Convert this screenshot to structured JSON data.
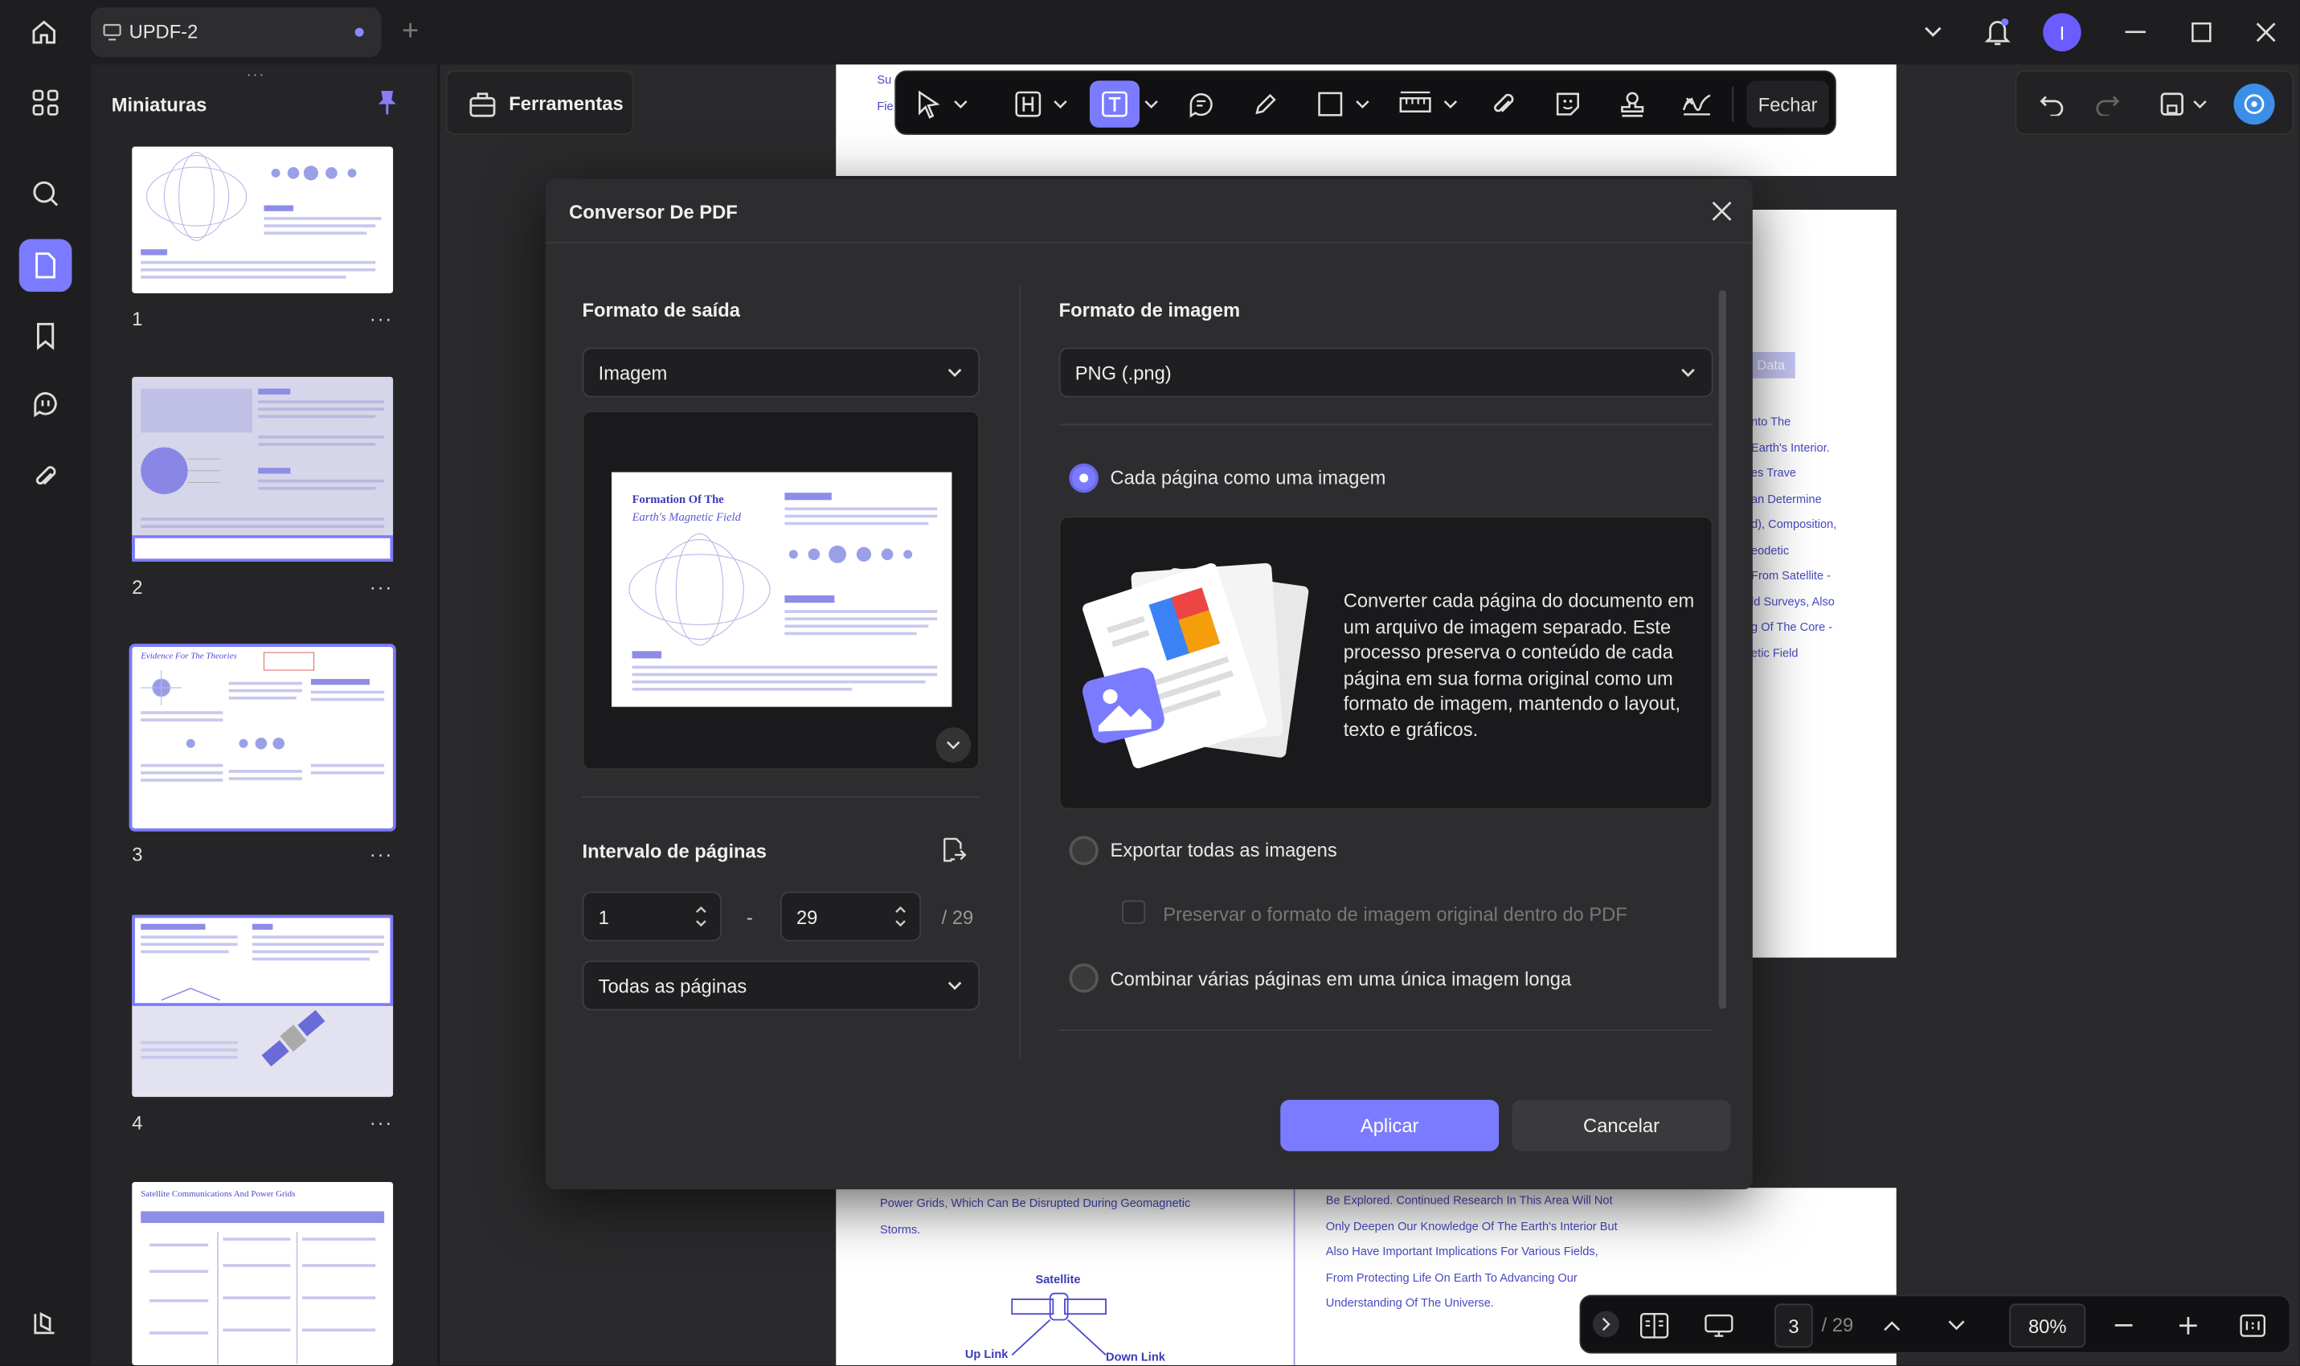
{
  "app": {
    "tab_title": "UPDF-2",
    "user_initial": "I"
  },
  "sidebar": {
    "panel_title": "Miniaturas",
    "pages": [
      {
        "num": "1"
      },
      {
        "num": "2"
      },
      {
        "num": "3"
      },
      {
        "num": "4"
      }
    ],
    "more": "···"
  },
  "toolbar": {
    "tools_label": "Ferramentas",
    "close_label": "Fechar"
  },
  "doc": {
    "top_text_1": "Su",
    "top_text_2": "Fie",
    "right_lines": [
      "Data",
      "nto The",
      "Earth's Interior.",
      "es Trave",
      "an Determine",
      "d), Composition,",
      "eodetic",
      "From Satellite -",
      "ld Surveys, Also",
      "g Of The Core -",
      "etic Field"
    ],
    "bottom_left_lines": [
      "Power Grids, Which Can Be Disrupted During Geomagnetic",
      "Storms."
    ],
    "bottom_right_lines": [
      "Be Explored. Continued Research In This Area Will Not",
      "Only Deepen Our Knowledge Of The Earth's Interior But",
      "Also Have Important Implications For Various Fields,",
      "From Protecting Life On Earth To Advancing Our",
      "Understanding Of The Universe."
    ],
    "diagram_labels": {
      "satellite": "Satellite",
      "uplink": "Up Link",
      "downlink": "Down Link"
    }
  },
  "modal": {
    "title": "Conversor De PDF",
    "output_format_label": "Formato de saída",
    "output_format_value": "Imagem",
    "preview_title_1": "Formation Of The",
    "preview_title_2": "Earth's Magnetic Field",
    "page_range_label": "Intervalo de páginas",
    "range_from": "1",
    "range_sep": "-",
    "range_to": "29",
    "range_total": "/ 29",
    "pages_select": "Todas as páginas",
    "image_format_label": "Formato de imagem",
    "image_format_value": "PNG (.png)",
    "option1": "Cada página como uma imagem",
    "option1_desc": "Converter cada página do documento em um arquivo de imagem separado. Este processo preserva o conteúdo de cada página em sua forma original como um formato de imagem, mantendo o layout, texto e gráficos.",
    "option2": "Exportar todas as imagens",
    "option2_sub": "Preservar o formato de imagem original dentro do PDF",
    "option3": "Combinar várias páginas em uma única imagem longa",
    "apply": "Aplicar",
    "cancel": "Cancelar"
  },
  "bottom": {
    "current_page": "3",
    "total_pages": "/ 29",
    "zoom": "80%"
  },
  "thumb_titles": {
    "t3": "Evidence For The Theories",
    "t5": "Satellite Communications And Power Grids"
  },
  "colors": {
    "accent": "#7b7bff",
    "bg": "#1c1c1e",
    "modal": "#2d2d30"
  }
}
